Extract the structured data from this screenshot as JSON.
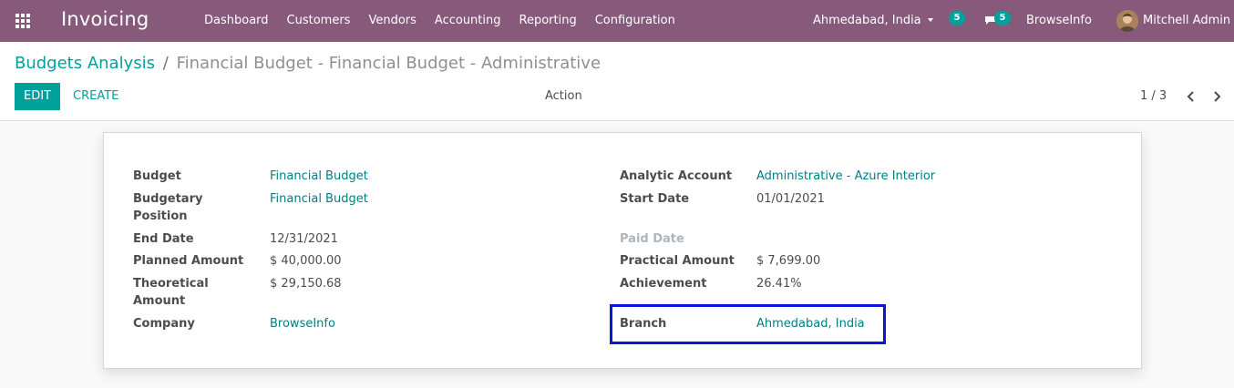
{
  "navbar": {
    "app_name": "Invoicing",
    "menu": [
      "Dashboard",
      "Customers",
      "Vendors",
      "Accounting",
      "Reporting",
      "Configuration"
    ],
    "branch": "Ahmedabad, India",
    "activity_count": "5",
    "message_count": "5",
    "company": "BrowseInfo",
    "user": "Mitchell Admin",
    "color": "#875a7b"
  },
  "breadcrumb": {
    "parent": "Budgets Analysis",
    "separator": "/",
    "current": "Financial Budget - Financial Budget - Administrative"
  },
  "buttons": {
    "edit": "EDIT",
    "create": "CREATE",
    "action": "Action"
  },
  "pager": {
    "value": "1 / 3"
  },
  "form": {
    "left": [
      {
        "label": "Budget",
        "value": "Financial Budget"
      },
      {
        "label": "Budgetary Position",
        "value": "Financial Budget"
      },
      {
        "label": "End Date",
        "value": "12/31/2021"
      },
      {
        "label": "Planned Amount",
        "value": "$ 40,000.00"
      },
      {
        "label": "Theoretical Amount",
        "value": "$ 29,150.68"
      },
      {
        "label": "Company",
        "value": "BrowseInfo"
      }
    ],
    "right": [
      {
        "label": "Analytic Account",
        "value": "Administrative - Azure Interior"
      },
      {
        "label": "Start Date",
        "value": "01/01/2021"
      },
      {
        "label": "Paid Date",
        "value": ""
      },
      {
        "label": "Practical Amount",
        "value": "$ 7,699.00"
      },
      {
        "label": "Achievement",
        "value": "26.41%"
      },
      {
        "label": "Branch",
        "value": "Ahmedabad, India"
      }
    ]
  },
  "colors": {
    "accent": "#00a09d",
    "link": "#017e84",
    "highlight": "#0b16d6"
  }
}
